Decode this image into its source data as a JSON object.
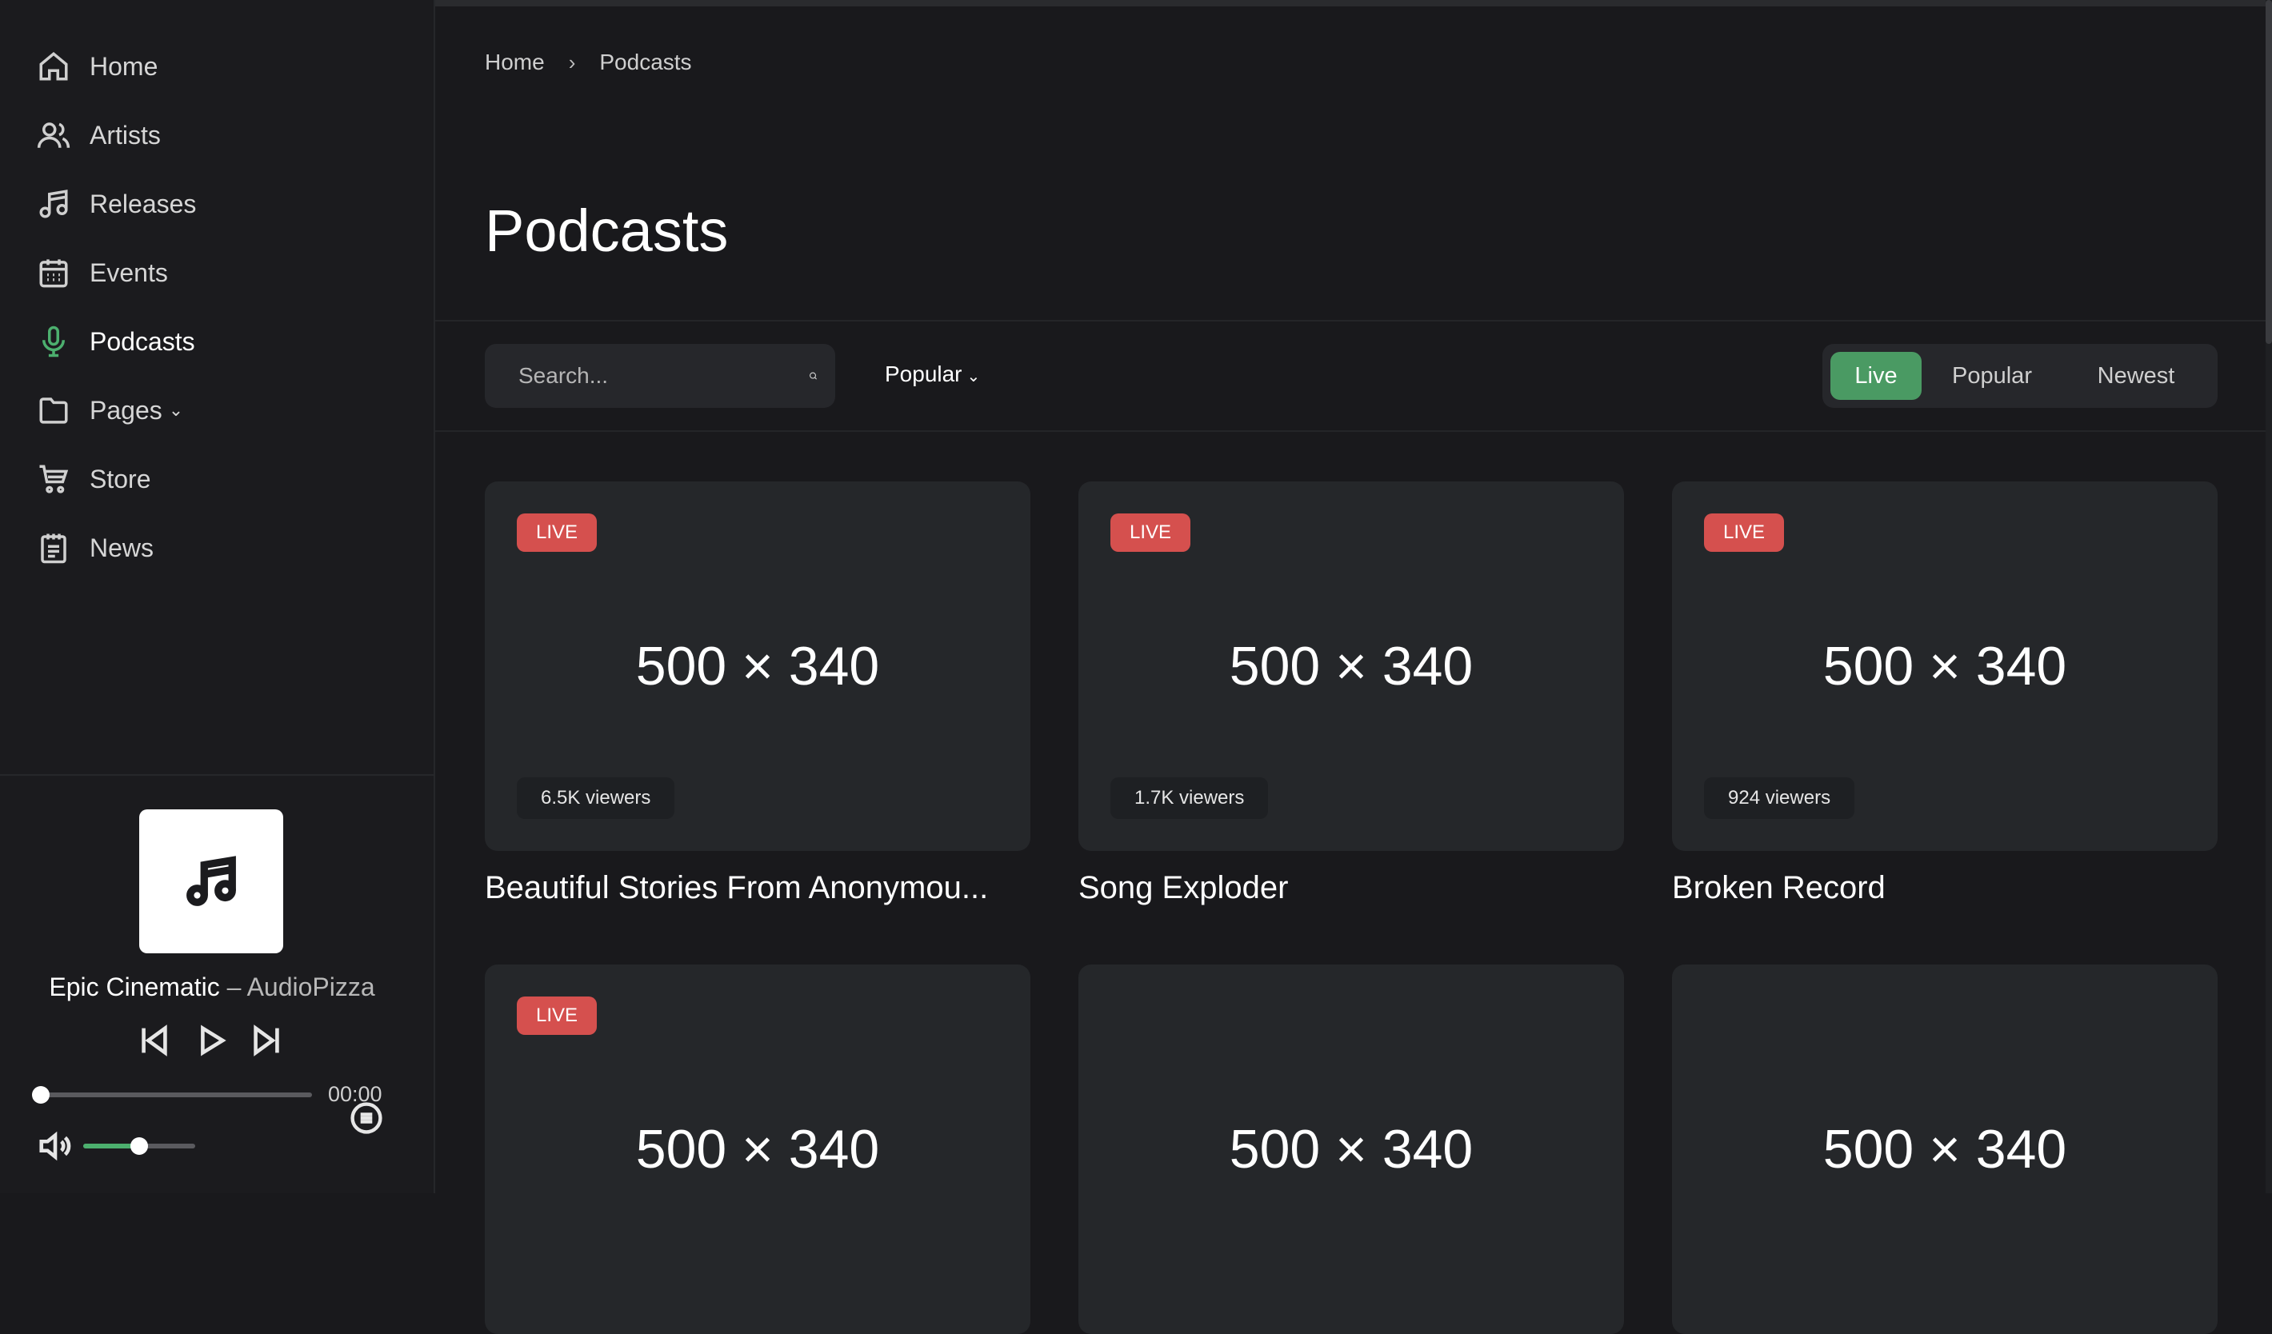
{
  "sidebar": {
    "items": [
      {
        "label": "Home",
        "icon": "home-icon"
      },
      {
        "label": "Artists",
        "icon": "users-icon"
      },
      {
        "label": "Releases",
        "icon": "music-note-icon"
      },
      {
        "label": "Events",
        "icon": "calendar-icon"
      },
      {
        "label": "Podcasts",
        "icon": "microphone-icon",
        "active": true
      },
      {
        "label": "Pages",
        "icon": "folder-icon"
      },
      {
        "label": "Store",
        "icon": "cart-icon"
      },
      {
        "label": "News",
        "icon": "news-icon"
      }
    ]
  },
  "player": {
    "title": "Epic Cinematic",
    "dash": "–",
    "artist": "AudioPizza",
    "time": "00:00",
    "progress": 0,
    "volume": 0.5
  },
  "breadcrumb": {
    "home": "Home",
    "separator": "›",
    "current": "Podcasts"
  },
  "page": {
    "title": "Podcasts"
  },
  "toolbar": {
    "search_placeholder": "Search...",
    "sort_label": "Popular",
    "filters": [
      "Live",
      "Popular",
      "Newest"
    ],
    "active_filter": "Live"
  },
  "cards": [
    {
      "dims": "500 × 340",
      "live": "LIVE",
      "viewers": "6.5K viewers",
      "title": "Beautiful Stories From Anonymou..."
    },
    {
      "dims": "500 × 340",
      "live": "LIVE",
      "viewers": "1.7K viewers",
      "title": "Song Exploder"
    },
    {
      "dims": "500 × 340",
      "live": "LIVE",
      "viewers": "924 viewers",
      "title": "Broken Record"
    },
    {
      "dims": "500 × 340",
      "live": "LIVE"
    },
    {
      "dims": "500 × 340"
    },
    {
      "dims": "500 × 340"
    }
  ],
  "colors": {
    "accent": "#4a9a63",
    "live": "#d5504e",
    "background": "#19191c"
  }
}
